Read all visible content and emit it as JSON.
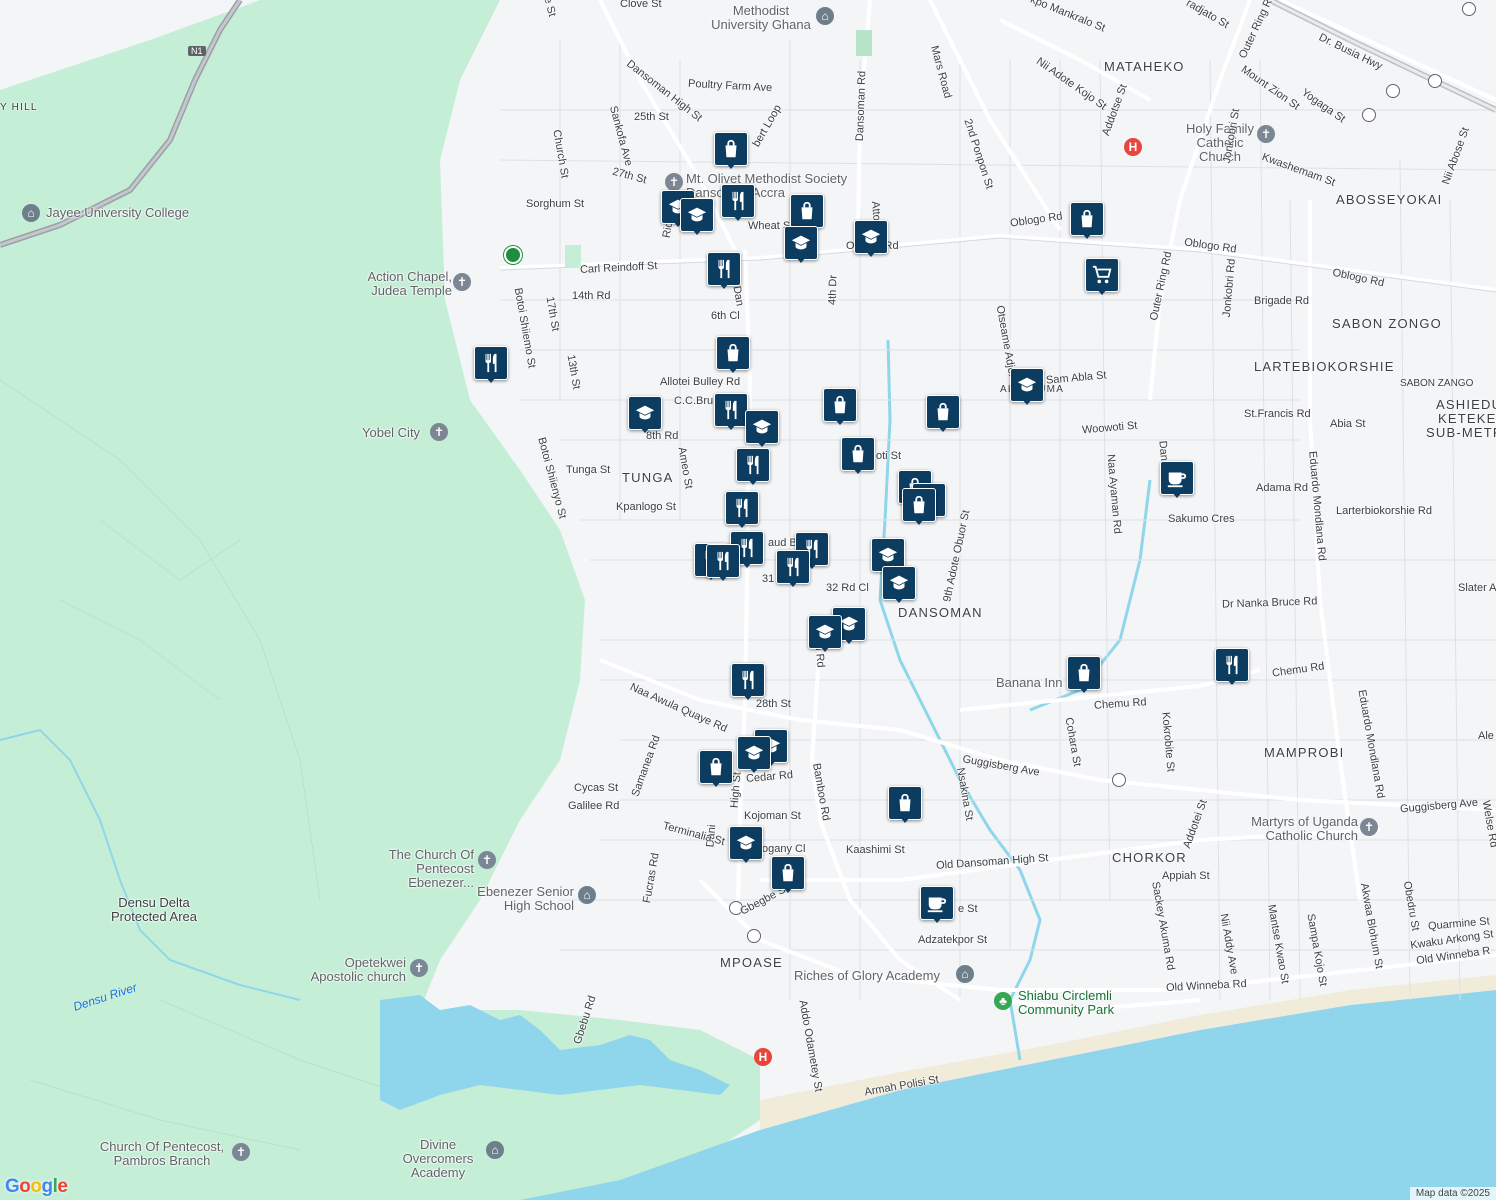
{
  "map": {
    "attribution": "Map data ©2025",
    "logo": "Google",
    "colors": {
      "land": "#f4f5f7",
      "park": "#c5eed6",
      "water": "#8fd6ec",
      "road": "#ffffff",
      "road_outline": "#d5d9de",
      "highway": "#9aa0a6",
      "marker": "#0c3c60"
    }
  },
  "area_labels": {
    "mataheko": "MATAHEKO",
    "abosseyokai": "ABOSSEYOKAI",
    "sabon_zongo": "SABON ZONGO",
    "lartebiokorshie": "LARTEBIOKORSHIE",
    "sabon_zango": "SABON ZANGO",
    "ashiedu_1": "ASHIEDU",
    "ashiedu_2": "KETEKE",
    "ashiedu_3": "SUB-METR",
    "ablekuma": "ABLEKUMA",
    "tunga": "TUNGA",
    "dansoman": "DANSOMAN",
    "mamprobi": "MAMPROBI",
    "chorkor": "CHORKOR",
    "mpoase": "MPOASE",
    "hill": "Y HILL"
  },
  "places": {
    "methodist_univ": "Methodist University Ghana",
    "holy_family": "Holy Family Catholic Church",
    "jayee": "Jayee University College",
    "mt_olivet": "Mt. Olivet Methodist Society Dansoman Accra",
    "action_chapel": "Action Chapel, Judea Temple",
    "yobel": "Yobel City",
    "banana_inn": "Banana Inn",
    "martyrs": "Martyrs of Uganda Catholic Church",
    "church_pentecost_ebenezer": "The Church Of Pentecost Ebenezer...",
    "ebenezer_shs": "Ebenezer Senior High School",
    "densu_delta": "Densu Delta Protected Area",
    "opetekwei": "Opetekwei Apostolic church",
    "densu_river": "Densu River",
    "riches": "Riches of Glory Academy",
    "shiabu": "Shiabu Circlemli Community Park",
    "pambros": "Church Of Pentecost, Pambros Branch",
    "divine": "Divine Overcomers Academy"
  },
  "streets": {
    "clove": "Clove St",
    "dansoman_high": "Dansoman High St",
    "poultry": "Poultry Farm Ave",
    "25th": "25th St",
    "27th": "27th St",
    "sankofa": "Sankofa Ave",
    "church": "Church St",
    "sorghum": "Sorghum St",
    "carl": "Carl Reindoff St",
    "14th": "14th Rd",
    "17th": "17th St",
    "13th": "13th St",
    "6th_cl": "6th Cl",
    "allotei": "Allotei Bulley Rd",
    "cc_bru": "C.C.Bru",
    "8th_rd": "8th Rd",
    "tunga_st": "Tunga St",
    "ameo": "Ameo St",
    "kpanlogo": "Kpanlogo St",
    "botoi_1": "Botoi Shiiemo St",
    "botoi_2": "Botoi Shiienyo St",
    "dansoman_rd": "Dansoman Rd",
    "mars": "Mars Road",
    "2nd_ponpon": "2nd Ponpon St",
    "4th_dr": "4th Dr",
    "obl_rd": "Oblogo Rd",
    "oblogo_1": "Oblogo Rd",
    "oblogo_2": "Oblogo Rd",
    "oblogo_3": "Oblogo Rd",
    "otseame": "Otseame Adjor St",
    "sam_abla": "Sam Abla St",
    "woowoti_1": "Woowoti St",
    "woowoti_2": "oti St",
    "naa_ayaman": "Naa Ayaman Rd",
    "adama": "Adama Rd",
    "sakumo": "Sakumo Cres",
    "lartebio_rd": "Larterbiokorshie Rd",
    "stfrancis": "St.Francis Rd",
    "abia": "Abia St",
    "brigade": "Brigade Rd",
    "jonkobri": "Jonkobri Rd",
    "outer_ring": "Outer Ring Rd",
    "outer_ring_2": "Outer Ring Rd",
    "eduardo_1": "Eduardo Mondlana Rd",
    "eduardo_2": "Eduardo Mondlana Rd",
    "slater": "Slater Av",
    "nanka": "Dr Nanka Bruce Rd",
    "chemu_1": "Chemu Rd",
    "chemu_2": "Chemu Rd",
    "cohara": "Cohara St",
    "kokrobite": "Kokrobite St",
    "guggisberg_1": "Guggisberg Ave",
    "guggisberg_2": "Guggisberg Ave",
    "nsakina": "Nsakina St",
    "32rd": "32 Rd Cl",
    "31": "31",
    "9th_adote": "9th Adote Obuor St",
    "28th": "28th St",
    "naa_awula": "Naa Awula Quaye Rd",
    "samanea": "Samanea Rd",
    "cycas": "Cycas St",
    "galilee": "Galilee Rd",
    "cedar": "Cedar Rd",
    "kojoman": "Kojoman St",
    "terminalia": "Terminalia St",
    "mahogany": "ogany Cl",
    "kaashimi": "Kaashimi St",
    "bamboo": "Bamboo Rd",
    "old_dansoman": "Old Dansoman High St",
    "appiah": "Appiah St",
    "addotei": "Addotei St",
    "sackey": "Sackey Akuma Rd",
    "nii_addy": "Nii Addy Ave",
    "mantse": "Mantse Kwao St",
    "sampa": "Sampa Kojo St",
    "akwaa": "Akwaa Blohum St",
    "obedru": "Obedru St",
    "quarmine": "Quarmine St",
    "kwaku": "Kwaku Arkong St",
    "old_winneba_1": "Old Winneba Rd",
    "old_winneba_2": "Old Winneba R",
    "fucras": "Fucras Rd",
    "gbegbe": "Gbegbe St",
    "adzatekpor": "Adzatekpor St",
    "gbebu": "Gbebu Rd",
    "addo_odametey": "Addo Odametey St",
    "armah": "Armah Polisi St",
    "nii_adote": "Nii Adote Kojo St",
    "addotse": "Addotse St",
    "mount_zion": "Mount Zion St",
    "yogaga": "Yogaga St",
    "kwashemam": "Kwashemam St",
    "jonkobri_2": "Jonkobri St",
    "nii_abose": "Nii Abose St",
    "dr_busia": "Dr. Busia Hwy",
    "mankralo": "kpo Mankralo St",
    "adjato": "radjato St",
    "wheat": "Wheat S",
    "rice": "Ric",
    "ebert": "bert Loop",
    "dan": "Dan",
    "daud": "aud B",
    "e_st": "e St",
    "attoh": "Atto",
    "ee_st": "ee St",
    "dani": "Dani",
    "dan_high_lower": "Dan",
    "high_lower": "High St",
    "h_rd": "h Rd",
    "e_rd": "Ale",
    "welse": "Welse Rd",
    "n1": "N1"
  },
  "markers": [
    {
      "type": "shopping",
      "icon": "shopping-bag-icon"
    },
    {
      "type": "restaurant",
      "icon": "fork-knife-icon"
    },
    {
      "type": "school",
      "icon": "graduation-cap-icon"
    },
    {
      "type": "cafe",
      "icon": "coffee-cup-icon"
    },
    {
      "type": "grocery",
      "icon": "shopping-cart-icon"
    }
  ]
}
